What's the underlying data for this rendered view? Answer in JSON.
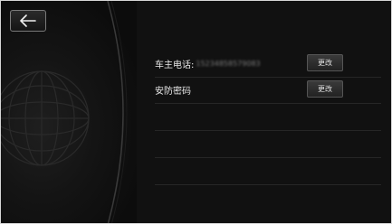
{
  "header": {
    "back_icon": "arrow-left-icon"
  },
  "settings": [
    {
      "label": "车主电话:",
      "value": "15234858579083",
      "button": "更改"
    },
    {
      "label": "安防密码",
      "value": "",
      "button": "更改"
    }
  ],
  "colors": {
    "background": "#111111",
    "text": "#e8e8e8",
    "button_border": "#555555"
  }
}
